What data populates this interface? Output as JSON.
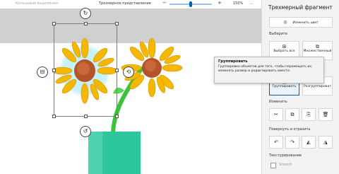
{
  "topbar": {
    "toolbar_hint": "Кольцевые выделения",
    "view_mode": "Трехмерное представление",
    "zoom_level": "150%",
    "zoom_fraction": 0.5
  },
  "panel": {
    "title": "Трехмерный фрагмент",
    "change_color": "Изменить цвет",
    "select_section": "Выберите",
    "select_all": "Выбрать все",
    "multi_select": "Множественный",
    "group": "Группировать",
    "ungroup": "Разгруппироват",
    "edit_section": "Изменить",
    "rotate_section": "Повернуть и отразить",
    "texture_section": "Текстурирование",
    "smooth": "Smooth"
  },
  "tooltip": {
    "title": "Группировать",
    "body": "Группировка объектов для того, чтобы перемещать их, изменять размер и редактировать вместе."
  },
  "icons": {
    "change_color": "palette-icon",
    "select_all": "select-all-icon",
    "multi_select": "multi-select-icon",
    "group": "group-icon",
    "ungroup": "ungroup-icon",
    "cut": "scissors-icon",
    "copy": "copy-icon",
    "paste": "paste-icon",
    "delete": "trash-icon",
    "rotate_left": "rotate-left-icon",
    "rotate_right": "rotate-right-icon",
    "flip_horizontal": "flip-horizontal-icon",
    "flip_vertical": "flip-vertical-icon"
  },
  "colors": {
    "accent": "#0063b1",
    "petal": "#f5b800",
    "stem": "#3cc33c",
    "vase": "#2ec79c"
  }
}
